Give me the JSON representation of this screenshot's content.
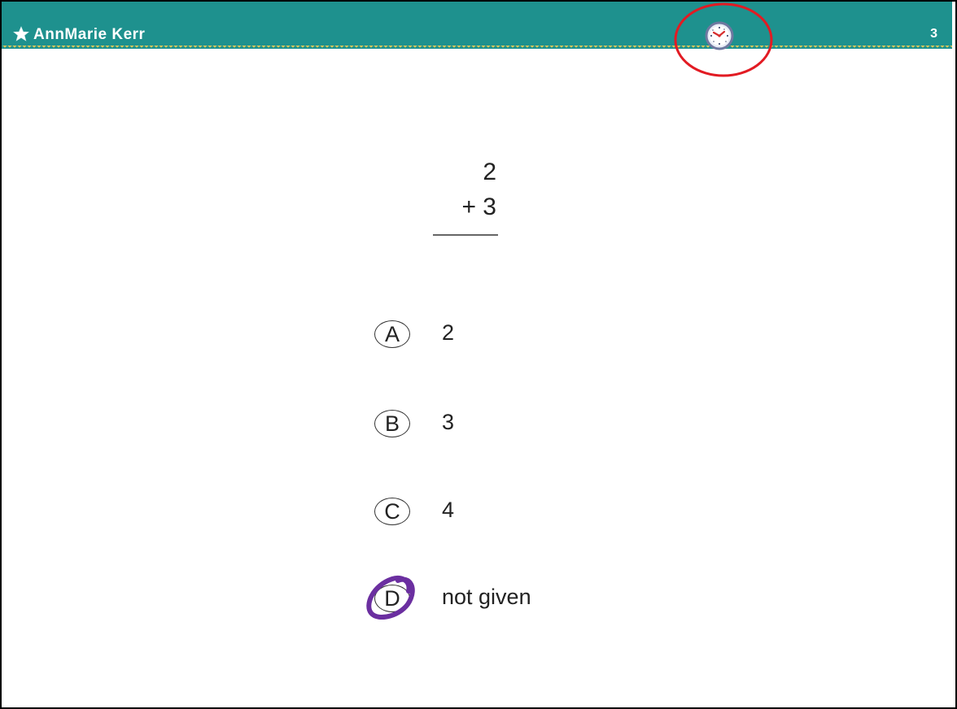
{
  "header": {
    "student_name": "AnnMarie Kerr",
    "page_number": "3",
    "background_color": "#1e918e",
    "clock_icon": "clock-icon",
    "highlight_color": "#e21b23"
  },
  "problem": {
    "top_addend": "2",
    "bottom_addend": "+ 3"
  },
  "choices": [
    {
      "letter": "A",
      "text": "2",
      "selected": false
    },
    {
      "letter": "B",
      "text": "3",
      "selected": false
    },
    {
      "letter": "C",
      "text": "4",
      "selected": false
    },
    {
      "letter": "D",
      "text": "not given",
      "selected": true
    }
  ],
  "selection_mark_color": "#6b2fa0"
}
